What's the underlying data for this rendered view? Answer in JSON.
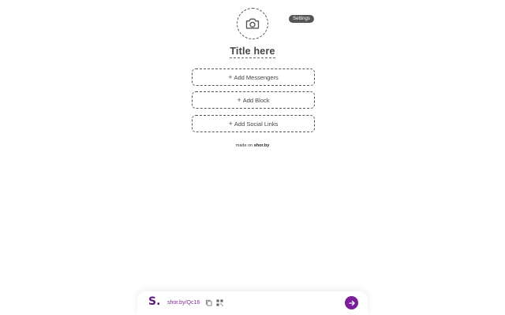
{
  "header": {
    "settings_label": "Settings",
    "title": "Title here"
  },
  "blocks": {
    "messengers_label": "Add Messengers",
    "block_label": "Add Block",
    "social_links_label": "Add Social Links",
    "plus_glyph": "+"
  },
  "footer": {
    "made_on_prefix": "made on",
    "brand": "shor.by"
  },
  "bottom_bar": {
    "logo": "S.",
    "short_link": "shor.by/Qc16"
  },
  "icons": {
    "avatar": "camera-icon",
    "copy": "copy-icon",
    "qr": "qr-code-icon",
    "go": "arrow-right-icon"
  },
  "colors": {
    "accent": "#7a1f9a",
    "logo": "#5e1a7a",
    "settings_bg": "#555555"
  }
}
